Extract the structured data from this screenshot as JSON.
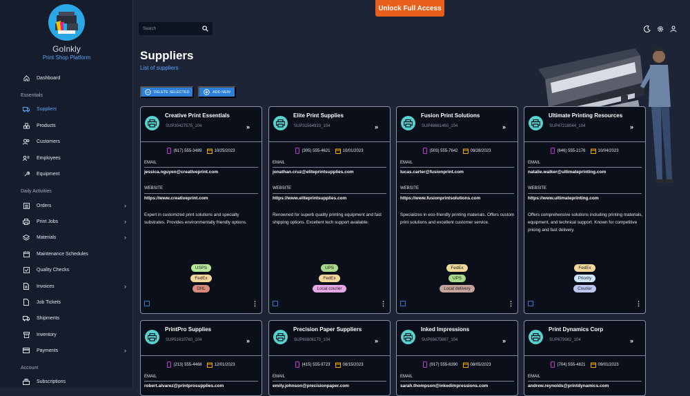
{
  "app": {
    "name": "GoInkly",
    "tagline": "Print Shop Platform",
    "unlock_label": "Unlock Full Access"
  },
  "sidebar": {
    "top_items": [
      {
        "label": "Dashboard",
        "icon": "home-icon"
      }
    ],
    "sections": [
      {
        "title": "Essentials",
        "items": [
          {
            "label": "Suppliers",
            "icon": "truck-icon",
            "active": true
          },
          {
            "label": "Products",
            "icon": "boxes-icon"
          },
          {
            "label": "Customers",
            "icon": "users-icon"
          },
          {
            "label": "Employees",
            "icon": "badge-icon"
          },
          {
            "label": "Equipment",
            "icon": "wrench-icon"
          }
        ]
      },
      {
        "title": "Daily Activities",
        "items": [
          {
            "label": "Orders",
            "icon": "list-icon",
            "chevron": true
          },
          {
            "label": "Print Jobs",
            "icon": "printer-icon",
            "chevron": true
          },
          {
            "label": "Materials",
            "icon": "layers-icon",
            "chevron": true
          },
          {
            "label": "Maintenance Schedules",
            "icon": "calendar-icon"
          },
          {
            "label": "Quality Checks",
            "icon": "check-icon"
          },
          {
            "label": "Invoices",
            "icon": "document-icon",
            "chevron": true
          },
          {
            "label": "Job Tickets",
            "icon": "ticket-icon"
          },
          {
            "label": "Shipments",
            "icon": "truck-icon"
          },
          {
            "label": "Inventory",
            "icon": "archive-icon"
          },
          {
            "label": "Payments",
            "icon": "card-icon",
            "chevron": true
          }
        ]
      },
      {
        "title": "Account",
        "items": [
          {
            "label": "Subscriptions",
            "icon": "stack-icon"
          }
        ]
      }
    ]
  },
  "header": {
    "search_placeholder": "Search",
    "icons": [
      "moon-icon",
      "gear-icon",
      "user-icon"
    ]
  },
  "page": {
    "title": "Suppliers",
    "subtitle": "List of suppliers",
    "delete_label": "DELETE SELECTED",
    "add_label": "ADD NEW"
  },
  "labels": {
    "email": "EMAIL",
    "website": "WEBSITE"
  },
  "colors": {
    "accent": "#58a6ff",
    "unlock": "#e8601c",
    "button": "#2b7fd9",
    "avatar": "#59d2cf"
  },
  "tag_colors": {
    "USPS": "#b7e89a",
    "FedEx": "#f4d79a",
    "DHL": "#d98a7c",
    "UPS": "#a9d98a",
    "Local courier": "#e7a6e6",
    "Local delivery": "#c7a39c",
    "Priority": "#cfe6ff",
    "Courier": "#b9c6f2"
  },
  "suppliers": [
    {
      "name": "Creative Print Essentials",
      "code": "SUP30427575_104",
      "phone": "(617) 555-3489",
      "date": "10/25/2023",
      "email": "jessica.nguyen@creativeprint.com",
      "website": "https://www.creativeprint.com",
      "description": "Expert in customized print solutions and specialty substrates. Provides environmentally friendly options.",
      "tags": [
        "USPS",
        "FedEx",
        "DHL"
      ]
    },
    {
      "name": "Elite Print Supplies",
      "code": "SUP31564933_104",
      "phone": "(305) 555-4621",
      "date": "10/01/2023",
      "email": "jonathan.cruz@eliteprintsupplies.com",
      "website": "https://www.eliteprintsupplies.com",
      "description": "Renowned for superb quality printing equipment and fast shipping options. Excellent tech support available.",
      "tags": [
        "UPS",
        "FedEx",
        "Local courier"
      ]
    },
    {
      "name": "Fusion Print Solutions",
      "code": "SUP46661460_104",
      "phone": "(503) 555-7642",
      "date": "09/28/2023",
      "email": "lucas.carter@fusionprint.com",
      "website": "https://www.fusionprintsolutions.com",
      "description": "Specializes in eco-friendly printing materials. Offers custom print solutions and excellent customer service.",
      "tags": [
        "FedEx",
        "UPS",
        "Local delivery"
      ]
    },
    {
      "name": "Ultimate Printing Resources",
      "code": "SUP47218044_104",
      "phone": "(646) 555-2176",
      "date": "10/04/2023",
      "email": "natalie.walker@ultimateprinting.com",
      "website": "https://www.ultimateprinting.com",
      "description": "Offers comprehensive solutions including printing materials, equipment, and technical support. Known for competitive pricing and fast delivery.",
      "tags": [
        "FedEx",
        "Priority",
        "Courier"
      ]
    },
    {
      "name": "PrintPro Supplies",
      "code": "SUP51610760_104",
      "phone": "(213) 555-4468",
      "date": "12/01/2023",
      "email": "robert.alvarez@printprosupplies.com",
      "website": "",
      "description": "",
      "tags": []
    },
    {
      "name": "Precision Paper Suppliers",
      "code": "SUP60806170_104",
      "phone": "(415) 555-9723",
      "date": "08/15/2023",
      "email": "emily.johnson@precisionpaper.com",
      "website": "",
      "description": "",
      "tags": []
    },
    {
      "name": "Inked Impressions",
      "code": "SUP65670867_104",
      "phone": "(917) 555-8390",
      "date": "08/05/2023",
      "email": "sarah.thompson@inkedimpressions.com",
      "website": "",
      "description": "",
      "tags": []
    },
    {
      "name": "Print Dynamics Corp",
      "code": "SUP679982_104",
      "phone": "(704) 555-4821",
      "date": "09/01/2023",
      "email": "andrew.reynolds@printdynamics.com",
      "website": "",
      "description": "",
      "tags": []
    }
  ]
}
